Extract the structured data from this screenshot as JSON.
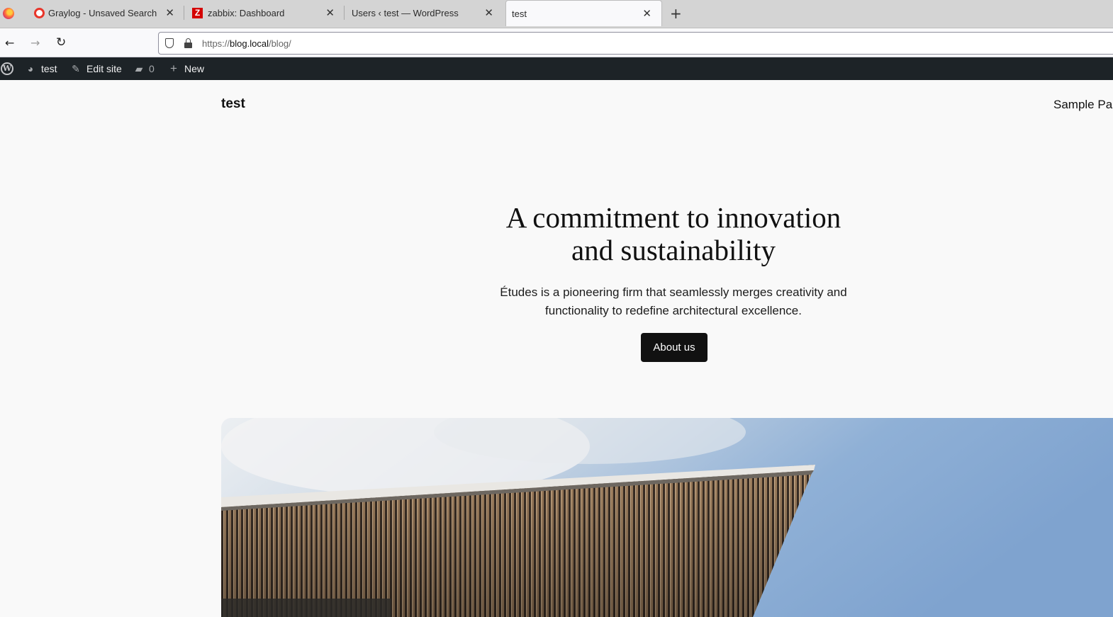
{
  "browser": {
    "tabs": [
      {
        "title": "Graylog - Unsaved Search",
        "icon": "graylog-icon"
      },
      {
        "title": "zabbix: Dashboard",
        "icon": "zabbix-icon"
      },
      {
        "title": "Users ‹ test — WordPress",
        "icon": "wordpress-icon"
      },
      {
        "title": "test",
        "icon": "none",
        "active": true
      }
    ],
    "url": {
      "scheme": "https://",
      "host": "blog.local",
      "path": "/blog/"
    }
  },
  "adminbar": {
    "site_name": "test",
    "edit_site": "Edit site",
    "comments_count": "0",
    "new_label": "New"
  },
  "site": {
    "title": "test",
    "nav_link": "Sample Pa"
  },
  "hero": {
    "heading_line1": "A commitment to innovation",
    "heading_line2": "and sustainability",
    "text_line1": "Études is a pioneering firm that seamlessly merges creativity and",
    "text_line2": "functionality to redefine architectural excellence.",
    "button_label": "About us",
    "image": "architecture-photo"
  },
  "colors": {
    "adminbar_bg": "#1d2327",
    "page_bg": "#f9f9f9",
    "button_bg": "#111111",
    "sky": "#8fb0d6"
  }
}
